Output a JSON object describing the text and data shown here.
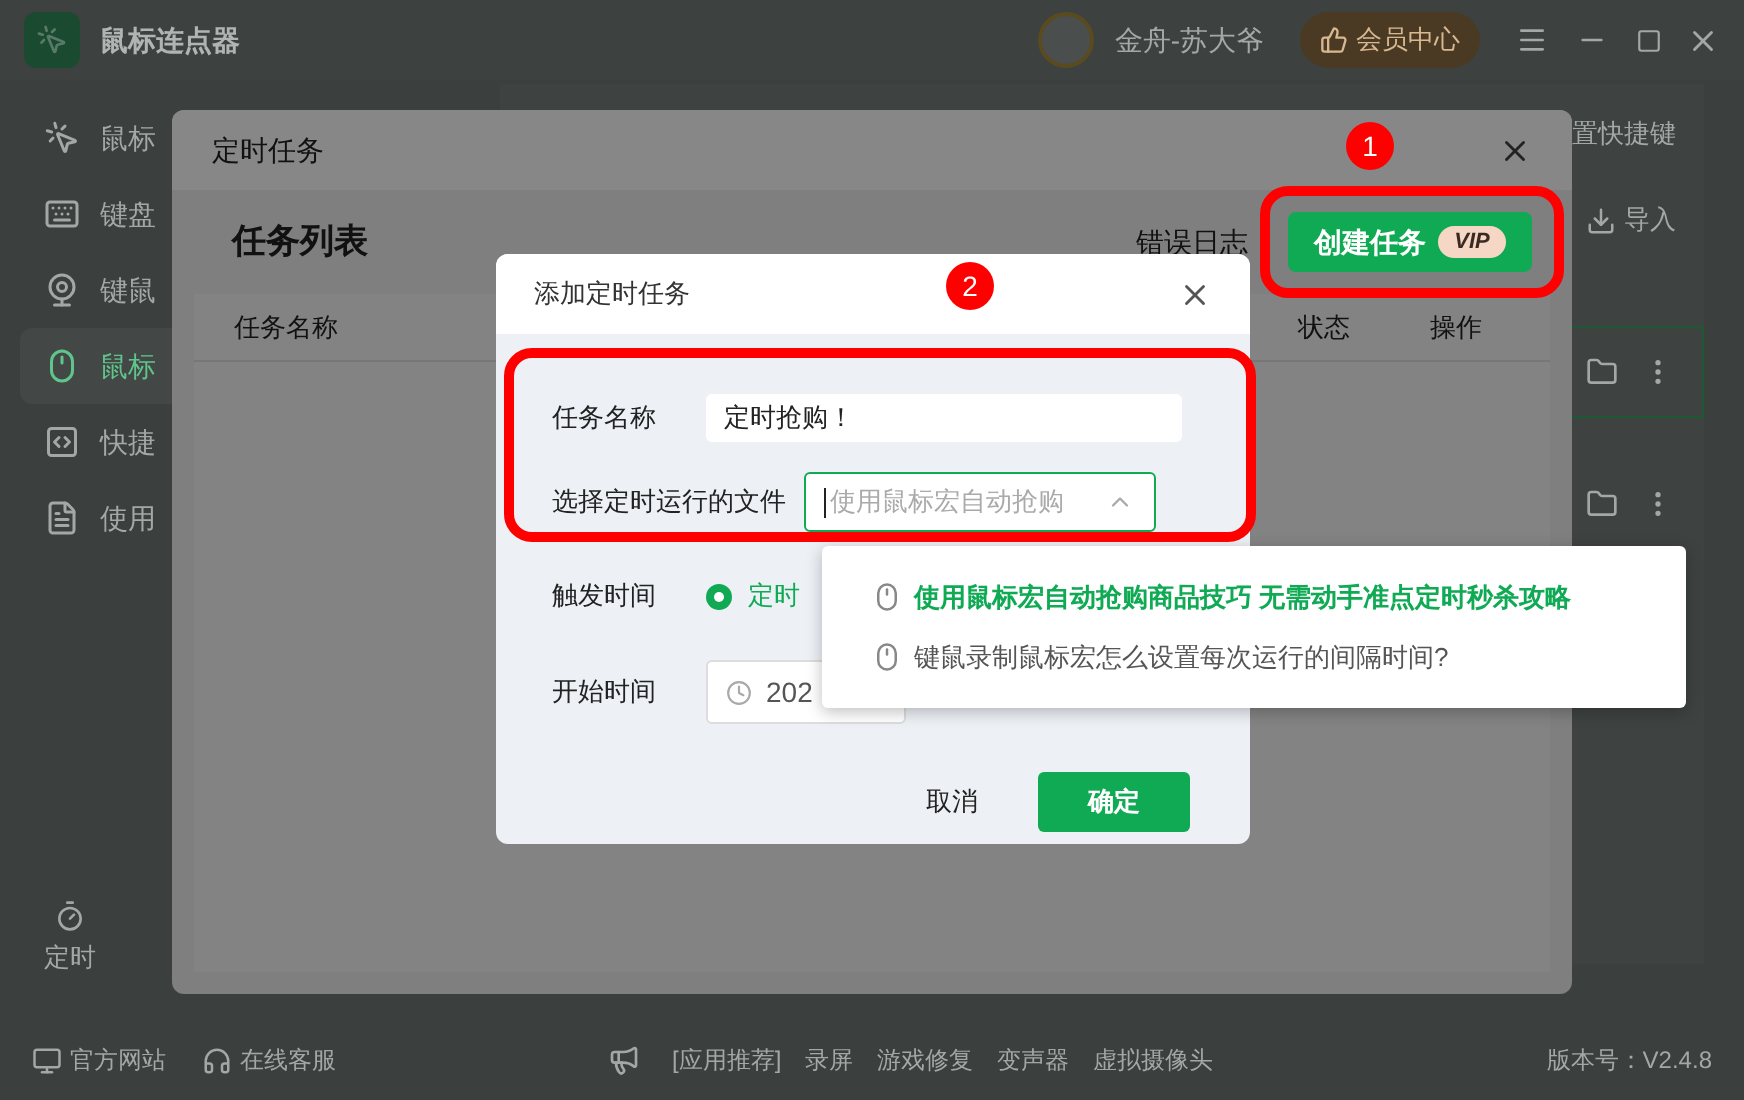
{
  "app": {
    "title": "鼠标连点器",
    "user": "金舟-苏大爷",
    "vip_button": "会员中心"
  },
  "sidebar": {
    "items": [
      {
        "label": "鼠标",
        "selected": false
      },
      {
        "label": "键盘",
        "selected": false
      },
      {
        "label": "键鼠",
        "selected": false
      },
      {
        "label": "鼠标",
        "selected": true
      },
      {
        "label": "快捷",
        "selected": false
      },
      {
        "label": "使用",
        "selected": false
      }
    ],
    "bottom_item": "定时"
  },
  "background_panel": {
    "shortcut_label": "置快捷键",
    "import_button": "导入",
    "rows": [
      {
        "selected": true
      },
      {
        "selected": false
      }
    ]
  },
  "schedule_window": {
    "title": "定时任务",
    "heading": "任务列表",
    "error_log": "错误日志",
    "create_button": "创建任务",
    "create_badge": "VIP",
    "columns": [
      "任务名称",
      "状态",
      "操作"
    ]
  },
  "add_dialog": {
    "title": "添加定时任务",
    "fields": [
      {
        "kind": "text",
        "label": "任务名称",
        "value": "定时抢购！"
      },
      {
        "kind": "select",
        "label": "选择定时运行的文件",
        "placeholder": "使用鼠标宏自动抢购",
        "expanded": true
      },
      {
        "kind": "radio",
        "label": "触发时间",
        "option": "定时",
        "checked": true
      },
      {
        "kind": "date",
        "label": "开始时间",
        "value": "202"
      }
    ],
    "cancel": "取消",
    "confirm": "确定"
  },
  "dropdown": {
    "items": [
      {
        "label": "使用鼠标宏自动抢购商品技巧 无需动手准点定时秒杀攻略",
        "selected": true
      },
      {
        "label": "键鼠录制鼠标宏怎么设置每次运行的间隔时间?",
        "selected": false
      }
    ]
  },
  "annotations": [
    {
      "number": "1"
    },
    {
      "number": "2"
    }
  ],
  "footer": {
    "links": [
      "官方网站",
      "在线客服"
    ],
    "apps_label": "[应用推荐]",
    "apps": [
      "录屏",
      "游戏修复",
      "变声器",
      "虚拟摄像头"
    ],
    "version": "版本号：V2.4.8"
  }
}
